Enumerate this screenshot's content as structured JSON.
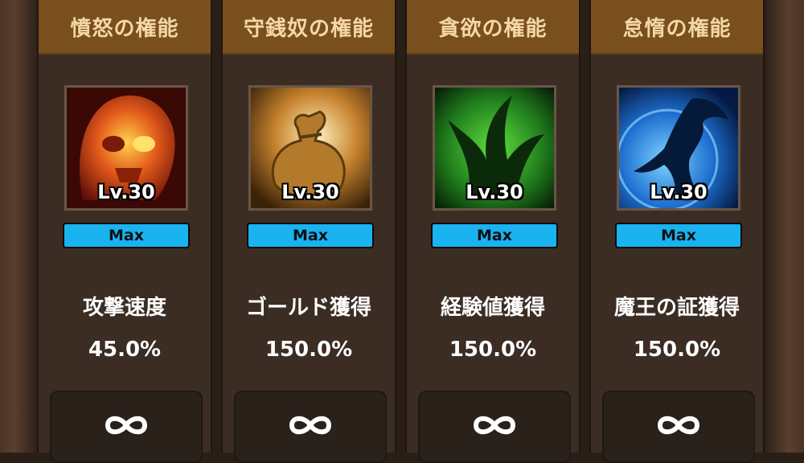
{
  "cards": [
    {
      "title": "憤怒の権能",
      "level": "Lv.30",
      "badge": "Max",
      "stat_name": "攻撃速度",
      "stat_value": "45.0%",
      "icon": "flaming-skull-icon",
      "accent": "#e2591b"
    },
    {
      "title": "守銭奴の権能",
      "level": "Lv.30",
      "badge": "Max",
      "stat_name": "ゴールド獲得",
      "stat_value": "150.0%",
      "icon": "gold-sack-icon",
      "accent": "#d8a043"
    },
    {
      "title": "貪欲の権能",
      "level": "Lv.30",
      "badge": "Max",
      "stat_name": "経験値獲得",
      "stat_value": "150.0%",
      "icon": "green-claw-icon",
      "accent": "#3fbf3a"
    },
    {
      "title": "怠惰の権能",
      "level": "Lv.30",
      "badge": "Max",
      "stat_name": "魔王の証獲得",
      "stat_value": "150.0%",
      "icon": "blue-mermaid-icon",
      "accent": "#1e8ff0"
    }
  ],
  "colors": {
    "header": "#7a4f1e",
    "title_text": "#f3d7a7",
    "max_bar": "#19b3ef",
    "card_bg": "#3b2d24"
  },
  "infinity_symbol": "infinity-icon"
}
